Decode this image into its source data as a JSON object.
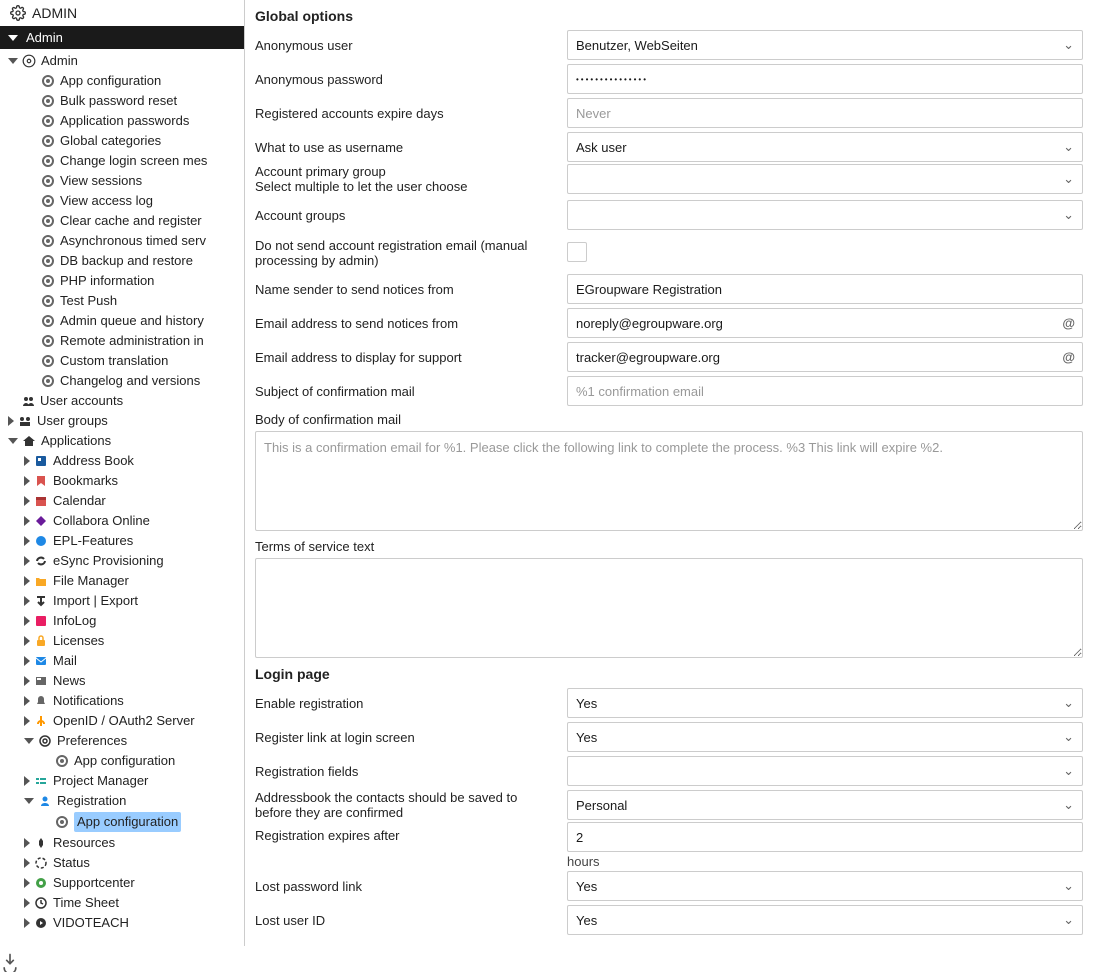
{
  "sidebar": {
    "header": "ADMIN",
    "section": "Admin",
    "admin": "Admin",
    "sub": {
      "appconfig": "App configuration",
      "bulk": "Bulk password reset",
      "apppw": "Application passwords",
      "globcat": "Global categories",
      "chlogin": "Change login screen mes",
      "viewsess": "View sessions",
      "viewacc": "View access log",
      "clearcache": "Clear cache and register",
      "async": "Asynchronous timed serv",
      "dbbackup": "DB backup and restore",
      "phpinfo": "PHP information",
      "testpush": "Test Push",
      "adminq": "Admin queue and history",
      "remote": "Remote administration in",
      "custrans": "Custom translation",
      "changelog": "Changelog and versions"
    },
    "useracc": "User accounts",
    "usergrp": "User groups",
    "apps": "Applications",
    "appitems": {
      "addr": "Address Book",
      "book": "Bookmarks",
      "cal": "Calendar",
      "coll": "Collabora Online",
      "epl": "EPL-Features",
      "esync": "eSync Provisioning",
      "filem": "File Manager",
      "impexp": "Import | Export",
      "infolog": "InfoLog",
      "lic": "Licenses",
      "mail": "Mail",
      "news": "News",
      "notif": "Notifications",
      "openid": "OpenID / OAuth2 Server",
      "pref": "Preferences",
      "prefac": "App configuration",
      "projm": "Project Manager",
      "reg": "Registration",
      "regac": "App configuration",
      "res": "Resources",
      "status": "Status",
      "supp": "Supportcenter",
      "ts": "Time Sheet",
      "vido": "VIDOTEACH"
    }
  },
  "sections": {
    "global": "Global options",
    "login": "Login page"
  },
  "labels": {
    "anonuser": "Anonymous user",
    "anonpw": "Anonymous password",
    "regexp": "Registered accounts expire days",
    "whatuse": "What to use as username",
    "accprim1": "Account primary group",
    "accprim2": "Select multiple to let the user choose",
    "accgrp": "Account groups",
    "donotsend": "Do not send account registration email (manual processing by admin)",
    "namesender": "Name sender to send notices from",
    "emailsend": "Email address to send notices from",
    "emailsupp": "Email address to display for support",
    "subjconf": "Subject of confirmation mail",
    "bodyconf": "Body of confirmation mail",
    "tos": "Terms of service text",
    "enreg": "Enable registration",
    "reglink": "Register link at login screen",
    "regfields": "Registration fields",
    "addrbook": "Addressbook the contacts should be saved to before they are confirmed",
    "regexpaf": "Registration expires after",
    "hours": "hours",
    "lostpw": "Lost password link",
    "lostid": "Lost user ID"
  },
  "values": {
    "anonuser": "Benutzer, WebSeiten",
    "anonpw": "•••••••••••••••",
    "regexp": "Never",
    "whatuse": "Ask user",
    "namesender": "EGroupware Registration",
    "emailsend": "noreply@egroupware.org",
    "emailsupp": "tracker@egroupware.org",
    "subjconf": "%1 confirmation email",
    "bodyconf": "This is a confirmation email for %1.  Please click the following link to complete the process.  %3  This link will expire %2.",
    "enreg": "Yes",
    "reglink": "Yes",
    "addrbook": "Personal",
    "regexpaf": "2",
    "lostpw": "Yes",
    "lostid": "Yes"
  }
}
